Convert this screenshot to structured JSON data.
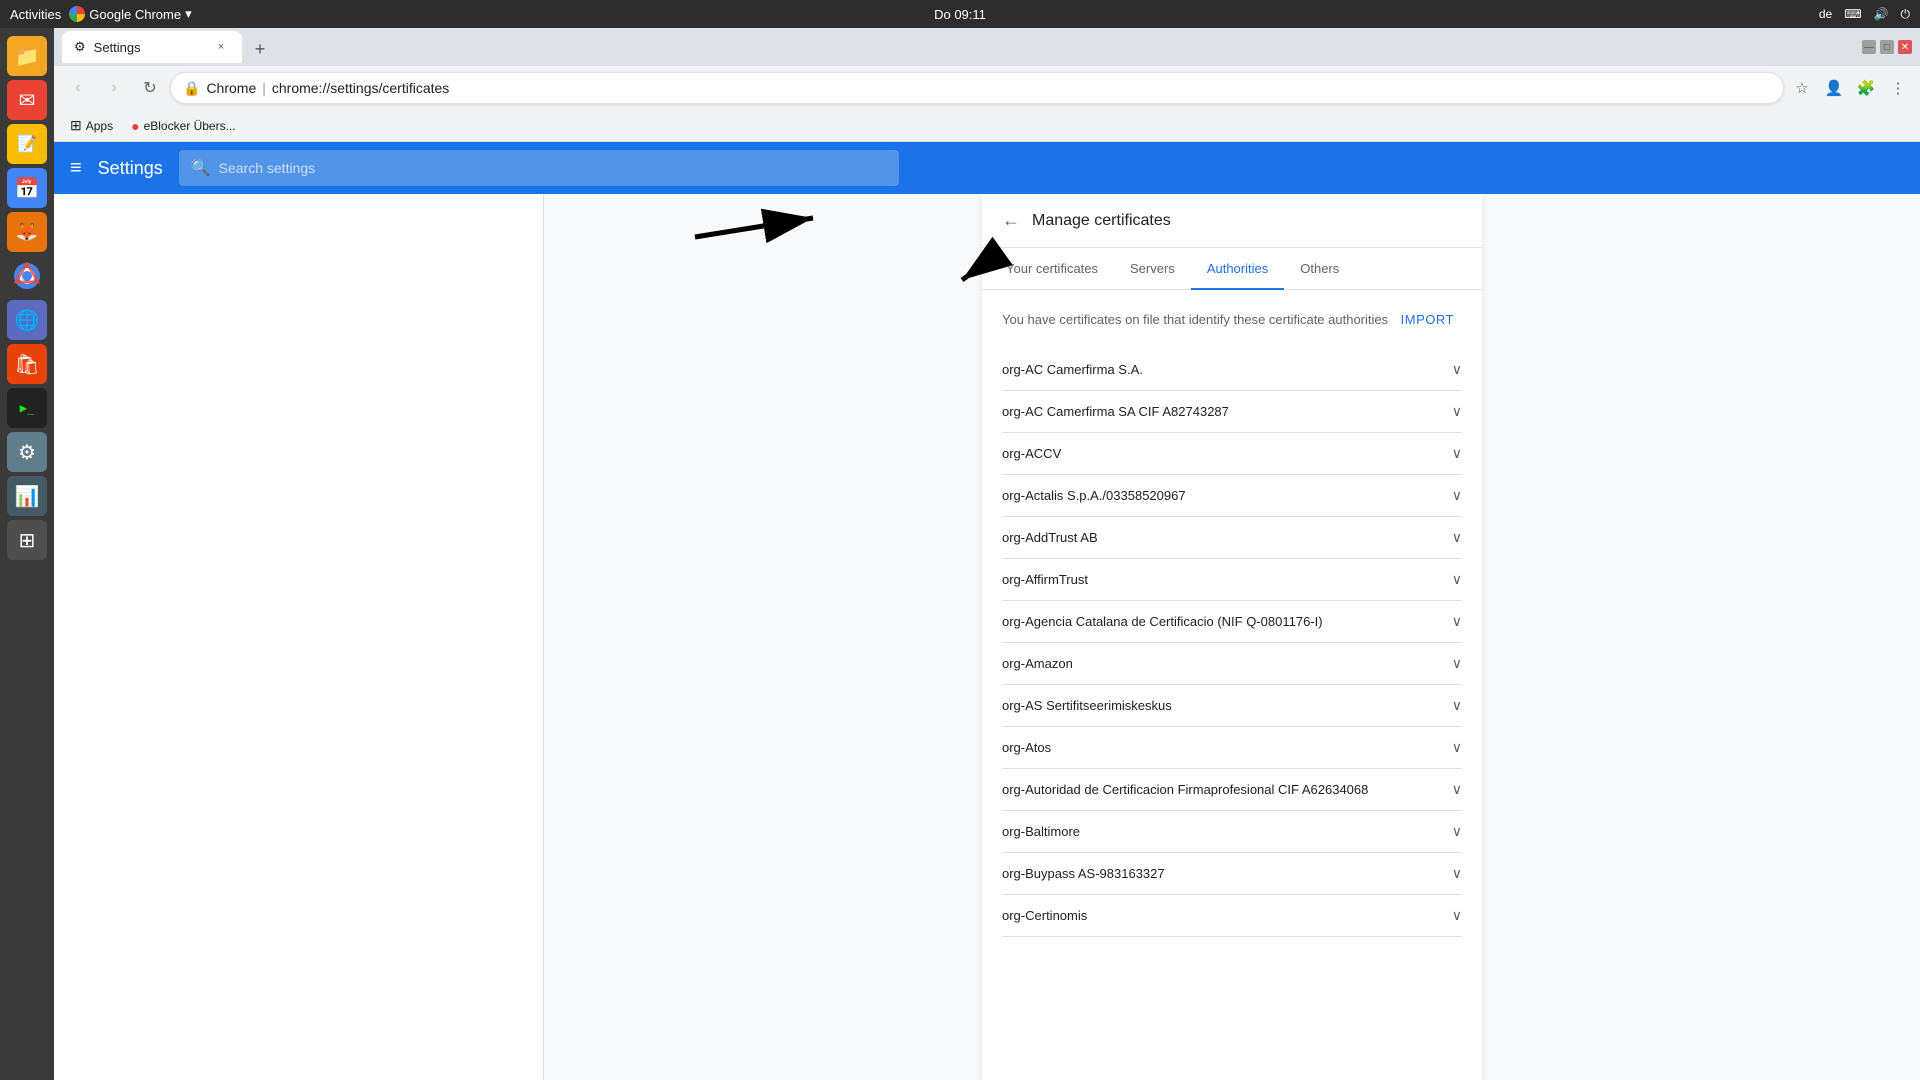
{
  "os": {
    "topbar": {
      "activities": "Activities",
      "app_name": "Google Chrome",
      "time": "Do 09:11",
      "layout_indicator": "de",
      "keyboard_icon": "⌨",
      "audio_icon": "🔊",
      "power_icon": "⏻"
    }
  },
  "browser": {
    "tab": {
      "favicon": "⚙",
      "title": "Settings",
      "close_label": "×"
    },
    "new_tab_label": "+",
    "address": {
      "secure_icon": "●",
      "site": "Chrome",
      "separator": "|",
      "path": "chrome://settings/certificates"
    },
    "actions": {
      "bookmark_icon": "☆",
      "profile_icon": "👤",
      "menu_icon": "⋮"
    },
    "bookmarks": [
      {
        "icon": "⊞",
        "label": "Apps"
      },
      {
        "icon": "🔴",
        "label": "eBlocker Übers..."
      }
    ]
  },
  "settings": {
    "header": {
      "menu_icon": "≡",
      "title": "Settings"
    },
    "search": {
      "placeholder": "Search settings",
      "icon": "🔍"
    }
  },
  "manage_certificates": {
    "back_icon": "←",
    "title": "Manage certificates",
    "tabs": [
      {
        "id": "your-certificates",
        "label": "Your certificates",
        "active": false
      },
      {
        "id": "servers",
        "label": "Servers",
        "active": false
      },
      {
        "id": "authorities",
        "label": "Authorities",
        "active": true
      },
      {
        "id": "others",
        "label": "Others",
        "active": false
      }
    ],
    "description": "You have certificates on file that identify these certificate authorities",
    "import_label": "IMPORT",
    "certificates": [
      {
        "name": "org-AC Camerfirma S.A."
      },
      {
        "name": "org-AC Camerfirma SA CIF A82743287"
      },
      {
        "name": "org-ACCV"
      },
      {
        "name": "org-Actalis S.p.A./03358520967"
      },
      {
        "name": "org-AddTrust AB"
      },
      {
        "name": "org-AffirmTrust"
      },
      {
        "name": "org-Agencia Catalana de Certificacio (NIF Q-0801176-I)"
      },
      {
        "name": "org-Amazon"
      },
      {
        "name": "org-AS Sertifitseerimiskeskus"
      },
      {
        "name": "org-Atos"
      },
      {
        "name": "org-Autoridad de Certificacion Firmaprofesional CIF A62634068"
      },
      {
        "name": "org-Baltimore"
      },
      {
        "name": "org-Buypass AS-983163327"
      },
      {
        "name": "org-Certinomis"
      }
    ],
    "chevron": "∨"
  },
  "dock_icons": [
    {
      "name": "files-icon",
      "symbol": "📁",
      "bg": "#f5a623"
    },
    {
      "name": "mail-icon",
      "symbol": "✉",
      "bg": "#ea4335"
    },
    {
      "name": "calendar-icon",
      "symbol": "📅",
      "bg": "#4285f4"
    },
    {
      "name": "text-editor-icon",
      "symbol": "📝",
      "bg": "#fbbc05"
    },
    {
      "name": "firefox-icon",
      "symbol": "🦊",
      "bg": "#e8730a"
    },
    {
      "name": "chrome-icon",
      "symbol": "◉",
      "bg": "transparent"
    },
    {
      "name": "vpn-icon",
      "symbol": "🌐",
      "bg": "#5c6bc0"
    },
    {
      "name": "app-store-icon",
      "symbol": "🛍",
      "bg": "#e8430a"
    },
    {
      "name": "terminal-icon",
      "symbol": ">_",
      "bg": "#333"
    },
    {
      "name": "system-settings-icon",
      "symbol": "⚙",
      "bg": "#607d8b"
    },
    {
      "name": "stats-icon",
      "symbol": "📊",
      "bg": "#455a64"
    },
    {
      "name": "all-apps-icon",
      "symbol": "⊞",
      "bg": "transparent"
    }
  ]
}
